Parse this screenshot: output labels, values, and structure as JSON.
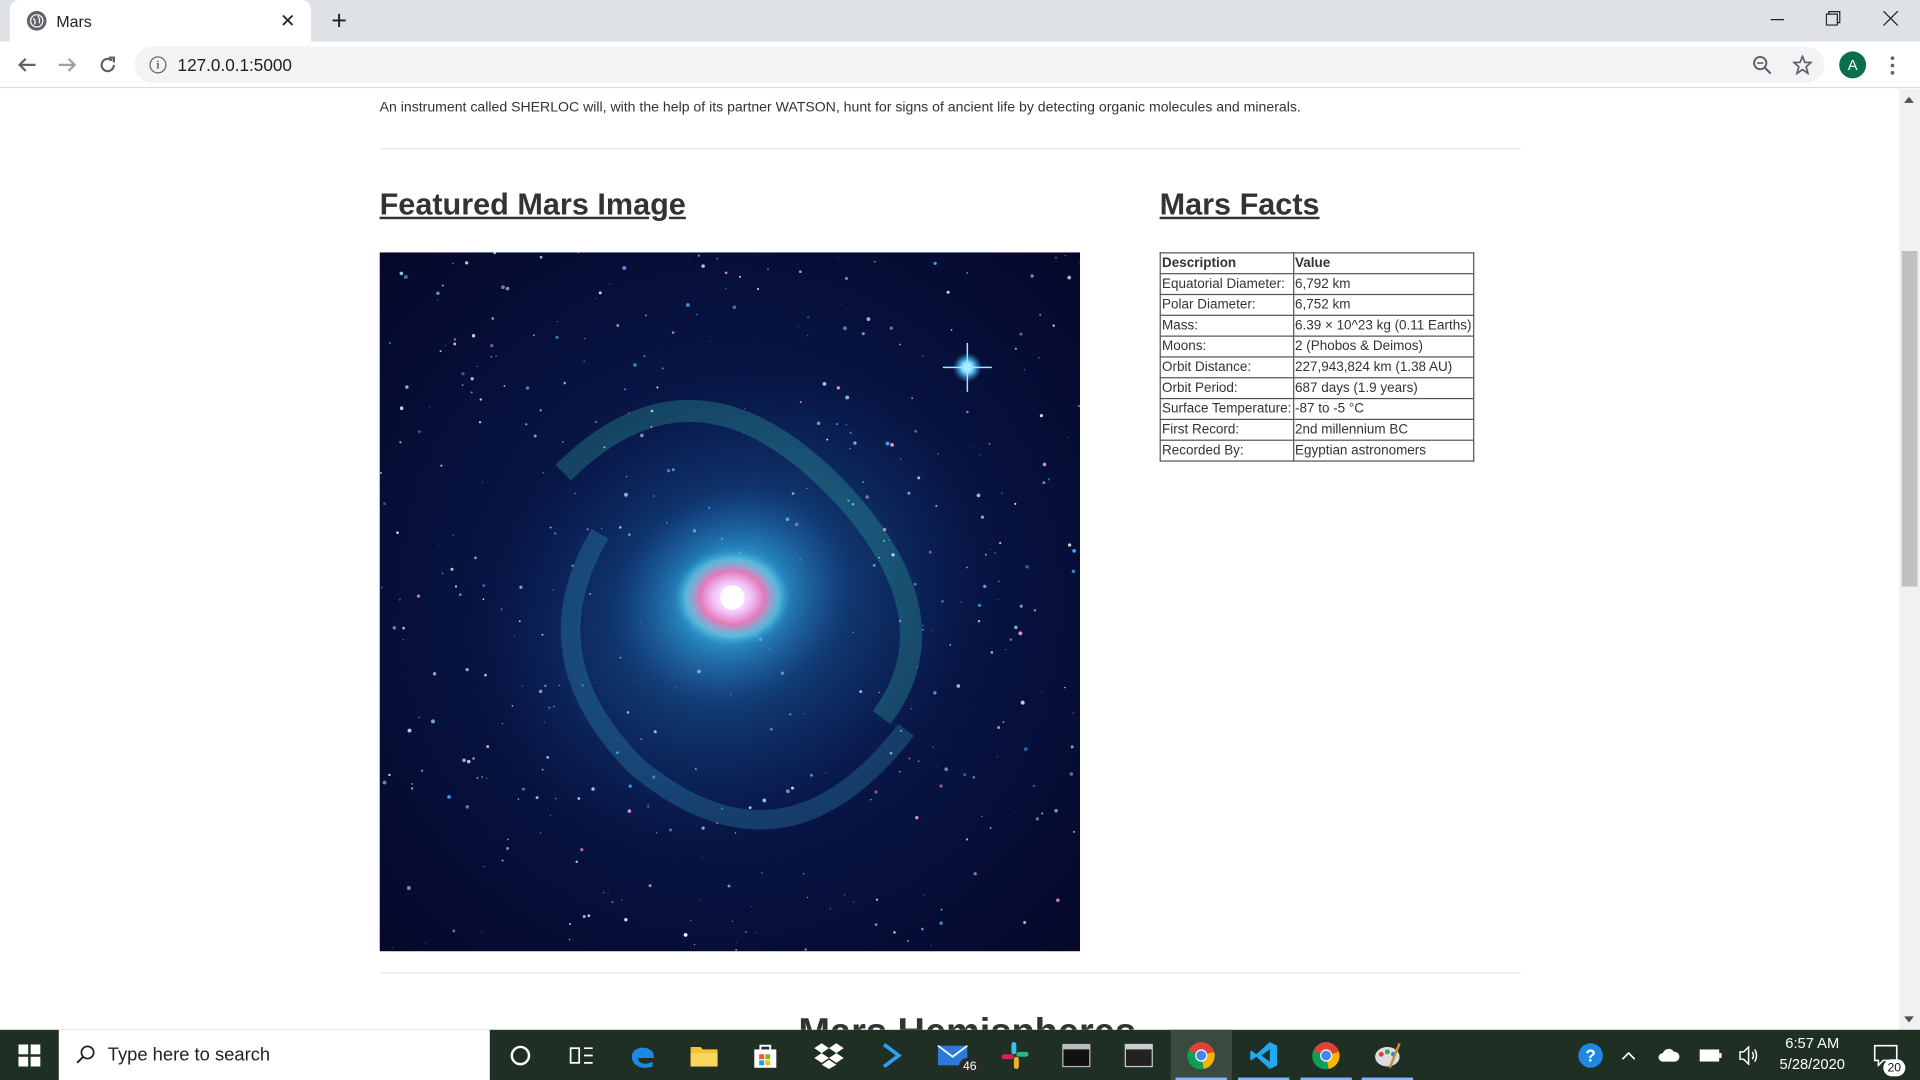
{
  "browser": {
    "tab_title": "Mars",
    "url": "127.0.0.1:5000",
    "avatar_letter": "A"
  },
  "page": {
    "news_paragraph": "An instrument called SHERLOC will, with the help of its partner WATSON, hunt for signs of ancient life by detecting organic molecules and minerals.",
    "featured_title": "Featured Mars Image",
    "facts_title": "Mars Facts",
    "hemispheres_title": "Mars Hemispheres",
    "facts_table": {
      "headers": [
        "Description",
        "Value"
      ],
      "rows": [
        [
          "Equatorial Diameter:",
          "6,792 km"
        ],
        [
          "Polar Diameter:",
          "6,752 km"
        ],
        [
          "Mass:",
          "6.39 × 10^23 kg (0.11 Earths)"
        ],
        [
          "Moons:",
          "2 (Phobos & Deimos)"
        ],
        [
          "Orbit Distance:",
          "227,943,824 km (1.38 AU)"
        ],
        [
          "Orbit Period:",
          "687 days (1.9 years)"
        ],
        [
          "Surface Temperature:",
          "-87 to -5 °C"
        ],
        [
          "First Record:",
          "2nd millennium BC"
        ],
        [
          "Recorded By:",
          "Egyptian astronomers"
        ]
      ]
    }
  },
  "taskbar": {
    "search_placeholder": "Type here to search",
    "mail_badge": "46",
    "notifications_badge": "20",
    "time": "6:57 AM",
    "date": "5/28/2020"
  }
}
